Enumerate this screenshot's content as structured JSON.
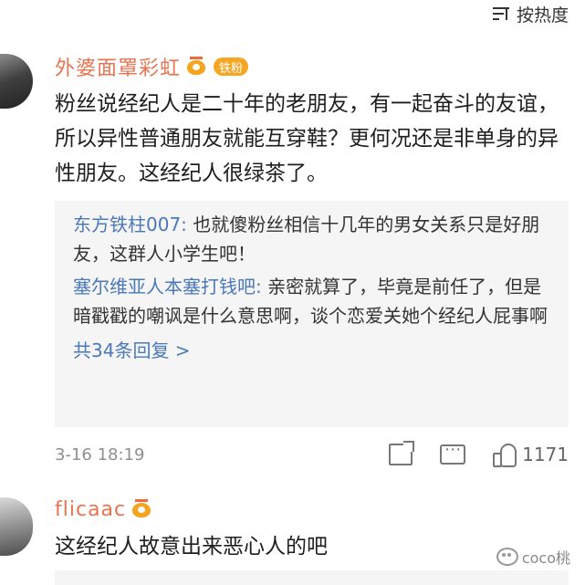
{
  "sort": {
    "label": "按热度",
    "icon": "sort-icon"
  },
  "comments": [
    {
      "username": "外婆面罩彩虹",
      "badge": "铁粉",
      "text": "粉丝说经纪人是二十年的老朋友，有一起奋斗的友谊，所以异性普通朋友就能互穿鞋？更何况还是非单身的异性朋友。这经纪人很绿茶了。",
      "replies": [
        {
          "name": "东方铁柱007:",
          "text": " 也就傻粉丝相信十几年的男女关系只是好朋友，这群人小学生吧！"
        },
        {
          "name": "塞尔维亚人本塞打钱吧:",
          "text": " 亲密就算了，毕竟是前任了，但是暗戳戳的嘲讽是什么意思啊，谈个恋爱关她个经纪人屁事啊"
        }
      ],
      "more_replies": "共34条回复 >",
      "time": "3-16 18:19",
      "likes": "1171"
    },
    {
      "username": "flicaac",
      "text": "这经纪人故意出来恶心人的吧"
    }
  ],
  "watermark": "coco桃",
  "colors": {
    "username": "#eb7350",
    "link": "#4a78b8",
    "badge": "#f5a623",
    "reply_bg": "#f5f5f5"
  }
}
